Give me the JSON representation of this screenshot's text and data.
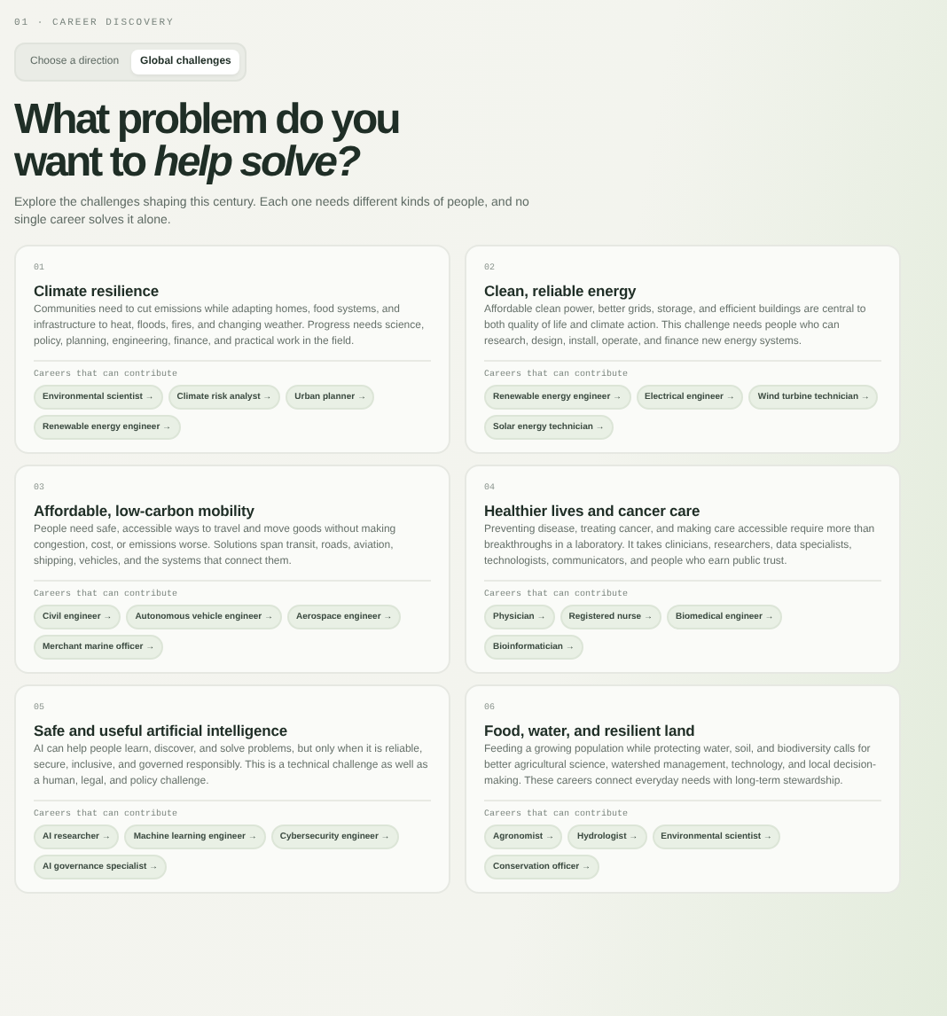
{
  "eyebrow": "01 · CAREER DISCOVERY",
  "tabs": [
    {
      "label": "Choose a direction",
      "selected": false
    },
    {
      "label": "Global challenges",
      "selected": true
    }
  ],
  "headline": "What problem do you want to *help solve?*",
  "intro": "Explore the challenges shaping this century. Each one needs different kinds of people, and no single career solves it alone.",
  "challenges": [
    {
      "number": "01",
      "title": "Climate resilience",
      "description": "Communities need to cut emissions while adapting homes, food systems, and infrastructure to heat, floods, fires, and changing weather. Progress needs science, policy, planning, engineering, finance, and practical work in the field.",
      "careers_label": "Careers that can contribute",
      "careers": [
        "Environmental scientist →",
        "Climate risk analyst →",
        "Urban planner →",
        "Renewable energy engineer →"
      ]
    },
    {
      "number": "02",
      "title": "Clean, reliable energy",
      "description": "Affordable clean power, better grids, storage, and efficient buildings are central to both quality of life and climate action. This challenge needs people who can research, design, install, operate, and finance new energy systems.",
      "careers_label": "Careers that can contribute",
      "careers": [
        "Renewable energy engineer →",
        "Electrical engineer →",
        "Wind turbine technician →",
        "Solar energy technician →"
      ]
    },
    {
      "number": "03",
      "title": "Affordable, low-carbon mobility",
      "description": "People need safe, accessible ways to travel and move goods without making congestion, cost, or emissions worse. Solutions span transit, roads, aviation, shipping, vehicles, and the systems that connect them.",
      "careers_label": "Careers that can contribute",
      "careers": [
        "Civil engineer →",
        "Autonomous vehicle engineer →",
        "Aerospace engineer →",
        "Merchant marine officer →"
      ]
    },
    {
      "number": "04",
      "title": "Healthier lives and cancer care",
      "description": "Preventing disease, treating cancer, and making care accessible require more than breakthroughs in a laboratory. It takes clinicians, researchers, data specialists, technologists, communicators, and people who earn public trust.",
      "careers_label": "Careers that can contribute",
      "careers": [
        "Physician →",
        "Registered nurse →",
        "Biomedical engineer →",
        "Bioinformatician →"
      ]
    },
    {
      "number": "05",
      "title": "Safe and useful artificial intelligence",
      "description": "AI can help people learn, discover, and solve problems, but only when it is reliable, secure, inclusive, and governed responsibly. This is a technical challenge as well as a human, legal, and policy challenge.",
      "careers_label": "Careers that can contribute",
      "careers": [
        "AI researcher →",
        "Machine learning engineer →",
        "Cybersecurity engineer →",
        "AI governance specialist →"
      ]
    },
    {
      "number": "06",
      "title": "Food, water, and resilient land",
      "description": "Feeding a growing population while protecting water, soil, and biodiversity calls for better agricultural science, watershed management, technology, and local decision-making. These careers connect everyday needs with long-term stewardship.",
      "careers_label": "Careers that can contribute",
      "careers": [
        "Agronomist →",
        "Hydrologist →",
        "Environmental scientist →",
        "Conservation officer →"
      ]
    }
  ]
}
